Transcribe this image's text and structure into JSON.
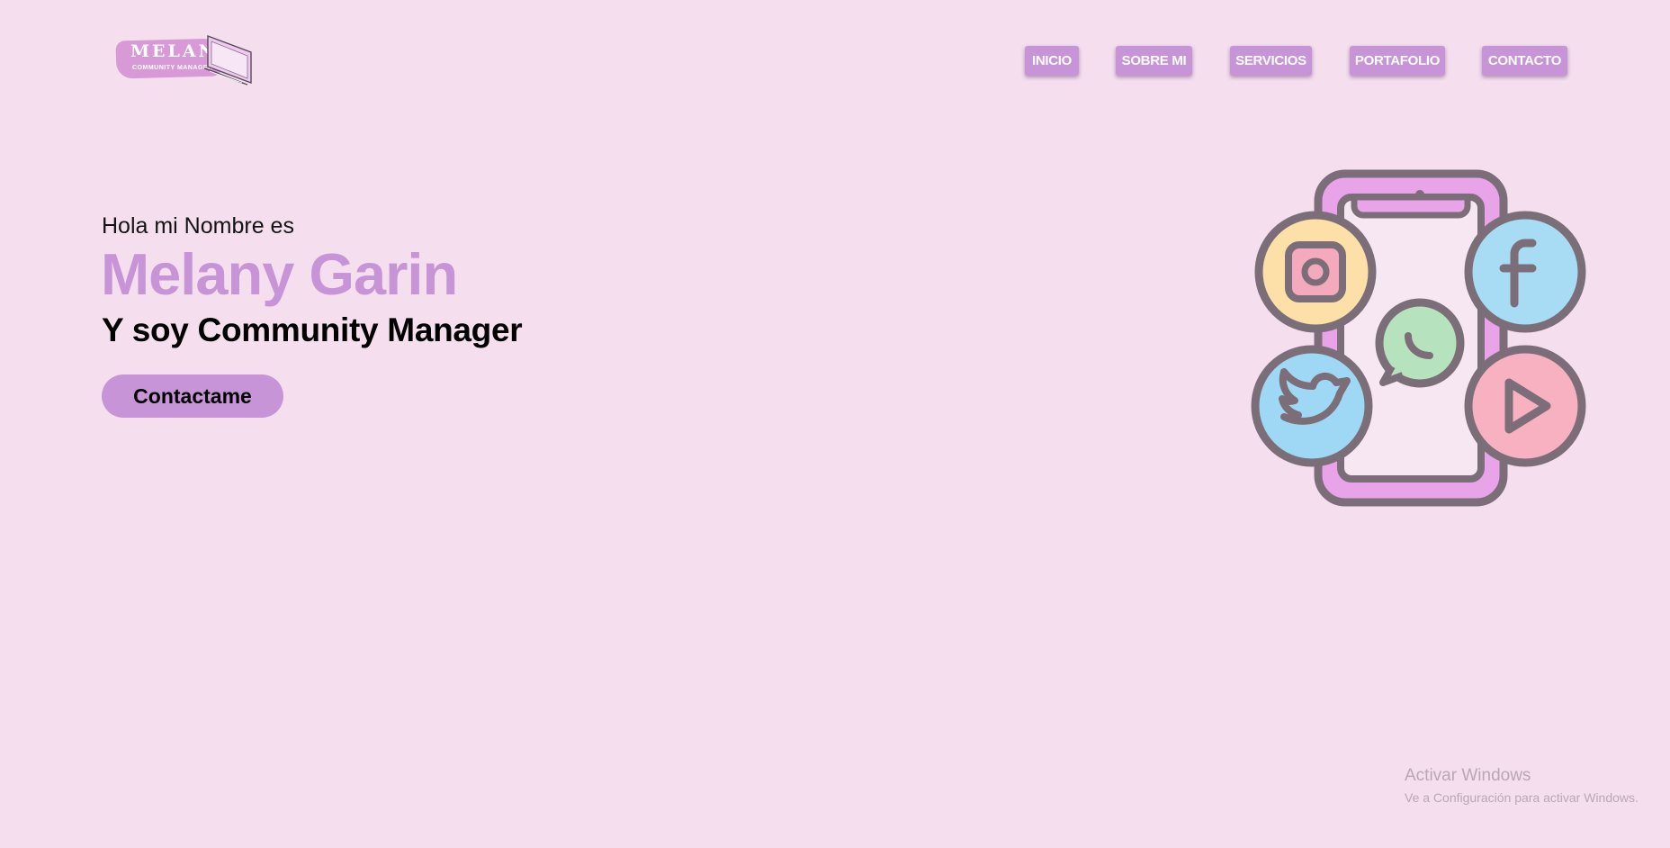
{
  "logo": {
    "name": "MELANY",
    "subtitle": "COMMUNITY MANAGER"
  },
  "nav": {
    "items": [
      "INICIO",
      "SOBRE MI",
      "SERVICIOS",
      "PORTAFOLIO",
      "CONTACTO"
    ]
  },
  "hero": {
    "greeting": "Hola mi Nombre es",
    "name": "Melany Garin",
    "role": "Y soy Community Manager",
    "cta_label": "Contactame"
  },
  "illustration": {
    "icons": [
      "phone-icon",
      "instagram-icon",
      "facebook-icon",
      "whatsapp-icon",
      "twitter-icon",
      "youtube-icon"
    ]
  },
  "watermark": {
    "title": "Activar Windows",
    "subtitle": "Ve a Configuración para activar Windows."
  },
  "colors": {
    "background": "#f5dfee",
    "accent": "#c794d8",
    "icon_stroke": "#7b6e78"
  }
}
